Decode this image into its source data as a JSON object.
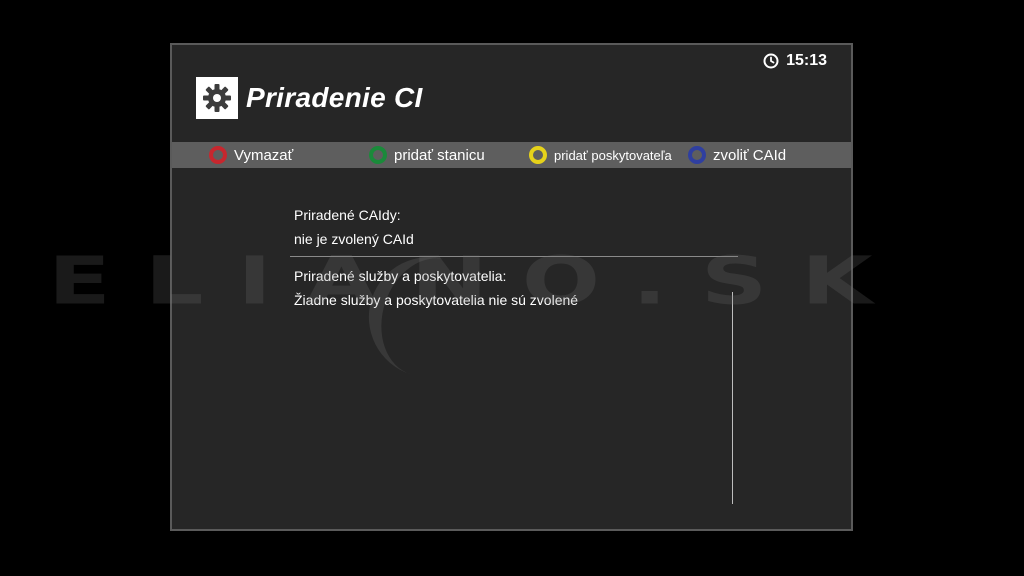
{
  "header": {
    "clock": "15:13",
    "title": "Priradenie CI"
  },
  "buttons": [
    {
      "label": "Vymazať",
      "color": "#c7272e"
    },
    {
      "label": "pridať stanicu",
      "color": "#1a8a3a"
    },
    {
      "label": "pridať poskytovateľa",
      "color": "#e6d21a"
    },
    {
      "label": "zvoliť CAId",
      "color": "#2f3fa0"
    }
  ],
  "caids": {
    "heading": "Priradené CAIdy:",
    "value": "nie je zvolený CAId"
  },
  "services": {
    "heading": "Priradené služby a poskytovatelia:",
    "value": "Žiadne služby a poskytovatelia nie sú zvolené"
  },
  "watermark": "ELIANO.SK",
  "icons": {
    "clock": "clock-icon",
    "settings": "gear-icon",
    "buttons": "color-key-dot-icon"
  }
}
